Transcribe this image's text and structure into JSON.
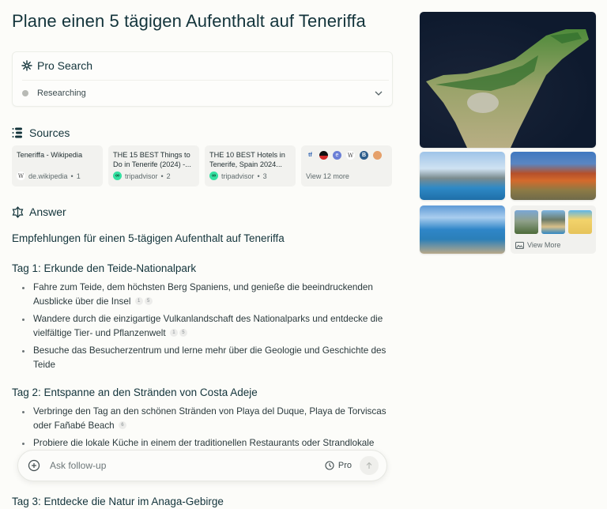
{
  "page": {
    "title": "Plane einen 5 tägigen Aufenthalt auf Teneriffa"
  },
  "pro_search": {
    "label": "Pro Search",
    "status": "Researching"
  },
  "sources": {
    "label": "Sources",
    "items": [
      {
        "title": "Teneriffa - Wikipedia",
        "site": "de.wikipedia",
        "index": "1",
        "favicon": "wikipedia-icon"
      },
      {
        "title": "THE 15 BEST Things to Do in Tenerife (2024) -...",
        "site": "tripadvisor",
        "index": "2",
        "favicon": "tripadvisor-icon"
      },
      {
        "title": "THE 10 BEST Hotels in Tenerife, Spain 2024...",
        "site": "tripadvisor",
        "index": "3",
        "favicon": "tripadvisor-icon"
      }
    ],
    "more": {
      "label": "View 12 more",
      "favicons": [
        "tf-icon",
        "black-red-circle-icon",
        "blue-swirl-icon",
        "wikipedia-icon",
        "b-icon",
        "orange-hand-icon"
      ]
    }
  },
  "answer": {
    "label": "Answer",
    "heading": "Empfehlungen für einen 5-tägigen Aufenthalt auf Teneriffa",
    "days": [
      {
        "title": "Tag 1: Erkunde den Teide-Nationalpark",
        "bullets": [
          {
            "text": "Fahre zum Teide, dem höchsten Berg Spaniens, und genieße die beeindruckenden Ausblicke über die Insel",
            "cites": [
              "1",
              "5"
            ]
          },
          {
            "text": "Wandere durch die einzigartige Vulkanlandschaft des Nationalparks und entdecke die vielfältige Tier- und Pflanzenwelt",
            "cites": [
              "1",
              "5"
            ]
          },
          {
            "text": "Besuche das Besucherzentrum und lerne mehr über die Geologie und Geschichte des Teide",
            "cites": []
          }
        ]
      },
      {
        "title": "Tag 2: Entspanne an den Stränden von Costa Adeje",
        "bullets": [
          {
            "text": "Verbringe den Tag an den schönen Stränden von Playa del Duque, Playa de Torviscas oder Fañabé Beach",
            "cites": [
              "6"
            ]
          },
          {
            "text": "Probiere die lokale Küche in einem der traditionellen Restaurants oder Strandlokale",
            "cites": []
          }
        ]
      },
      {
        "title": "Tag 3: Entdecke die Natur im Anaga-Gebirge",
        "bullets": []
      }
    ]
  },
  "followup": {
    "placeholder": "Ask follow-up",
    "value": "",
    "pro_label": "Pro"
  },
  "images": {
    "view_more_label": "View More",
    "items": [
      "Satellite view of Tenerife",
      "Coastal town with Teide in background",
      "Red volcanic rock landscape",
      "Coastal village and blue sea"
    ]
  }
}
